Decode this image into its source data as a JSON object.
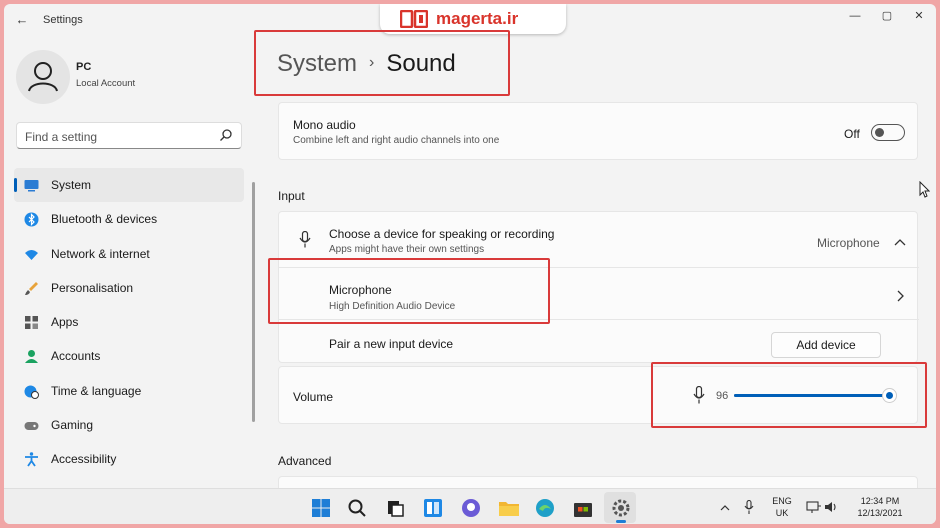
{
  "window": {
    "back_glyph": "←",
    "title": "Settings",
    "minimize_glyph": "—",
    "maximize_glyph": "▢",
    "close_glyph": "✕"
  },
  "watermark": {
    "text": "magerta.ir",
    "color": "#d9342b"
  },
  "user": {
    "name": "PC",
    "account_type": "Local Account",
    "icon": "person-icon"
  },
  "search": {
    "placeholder": "Find a setting",
    "icon": "search-icon"
  },
  "sidebar": {
    "items": [
      {
        "label": "System",
        "icon": "monitor-icon",
        "active": true
      },
      {
        "label": "Bluetooth & devices",
        "icon": "bluetooth-icon"
      },
      {
        "label": "Network & internet",
        "icon": "wifi-icon"
      },
      {
        "label": "Personalisation",
        "icon": "brush-icon"
      },
      {
        "label": "Apps",
        "icon": "apps-icon"
      },
      {
        "label": "Accounts",
        "icon": "accounts-icon"
      },
      {
        "label": "Time & language",
        "icon": "globe-clock-icon"
      },
      {
        "label": "Gaming",
        "icon": "gamepad-icon"
      },
      {
        "label": "Accessibility",
        "icon": "accessibility-icon"
      }
    ]
  },
  "header": {
    "parent": "System",
    "separator": "›",
    "current": "Sound"
  },
  "mono_audio": {
    "title": "Mono audio",
    "subtitle": "Combine left and right audio channels into one",
    "state_label": "Off"
  },
  "input_section": {
    "heading": "Input",
    "choose_device": {
      "title": "Choose a device for speaking or recording",
      "subtitle": "Apps might have their own settings",
      "selected": "Microphone",
      "icon": "microphone-icon"
    },
    "microphone": {
      "title": "Microphone",
      "subtitle": "High Definition Audio Device"
    },
    "pair": {
      "title": "Pair a new input device",
      "button": "Add device"
    },
    "volume": {
      "title": "Volume",
      "value": "96",
      "level": 0.96,
      "icon": "microphone-icon"
    }
  },
  "advanced_section": {
    "heading": "Advanced"
  },
  "taskbar": {
    "icons": [
      "windows-start-icon",
      "search-icon",
      "task-view-icon",
      "widgets-icon",
      "chat-icon",
      "file-explorer-icon",
      "edge-icon",
      "store-icon",
      "settings-icon"
    ],
    "tray": {
      "lang_top": "ENG",
      "lang_bottom": "UK",
      "time": "12:34 PM",
      "date": "12/13/2021"
    }
  },
  "colors": {
    "accent": "#005fb8",
    "highlight_box": "#d93a3a"
  }
}
